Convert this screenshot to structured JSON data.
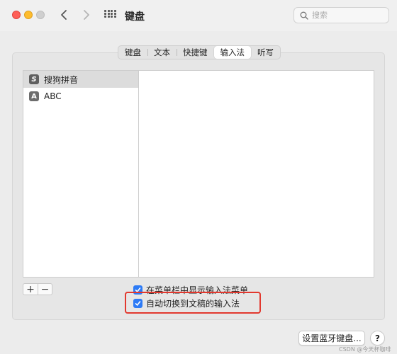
{
  "window": {
    "title": "键盘"
  },
  "search": {
    "placeholder": "搜索"
  },
  "tabs": [
    {
      "label": "键盘"
    },
    {
      "label": "文本"
    },
    {
      "label": "快捷键"
    },
    {
      "label": "输入法",
      "active": true
    },
    {
      "label": "听写"
    }
  ],
  "input_sources": [
    {
      "label": "搜狗拼音",
      "icon": "S",
      "selected": true
    },
    {
      "label": "ABC",
      "icon": "A",
      "selected": false
    }
  ],
  "list_controls": {
    "add_label": "+",
    "remove_label": "−"
  },
  "options": {
    "show_menu_label": "在菜单栏中显示输入法菜单",
    "show_menu_checked": true,
    "auto_switch_label": "自动切换到文稿的输入法",
    "auto_switch_checked": true
  },
  "footer": {
    "bluetooth_button": "设置蓝牙键盘...",
    "help_label": "?"
  },
  "watermark": "CSDN @今天杯咖啡",
  "colors": {
    "checkbox": "#2d7bf6",
    "highlight": "#e2382e",
    "close": "#fe5f57",
    "minimize": "#febc2e"
  }
}
